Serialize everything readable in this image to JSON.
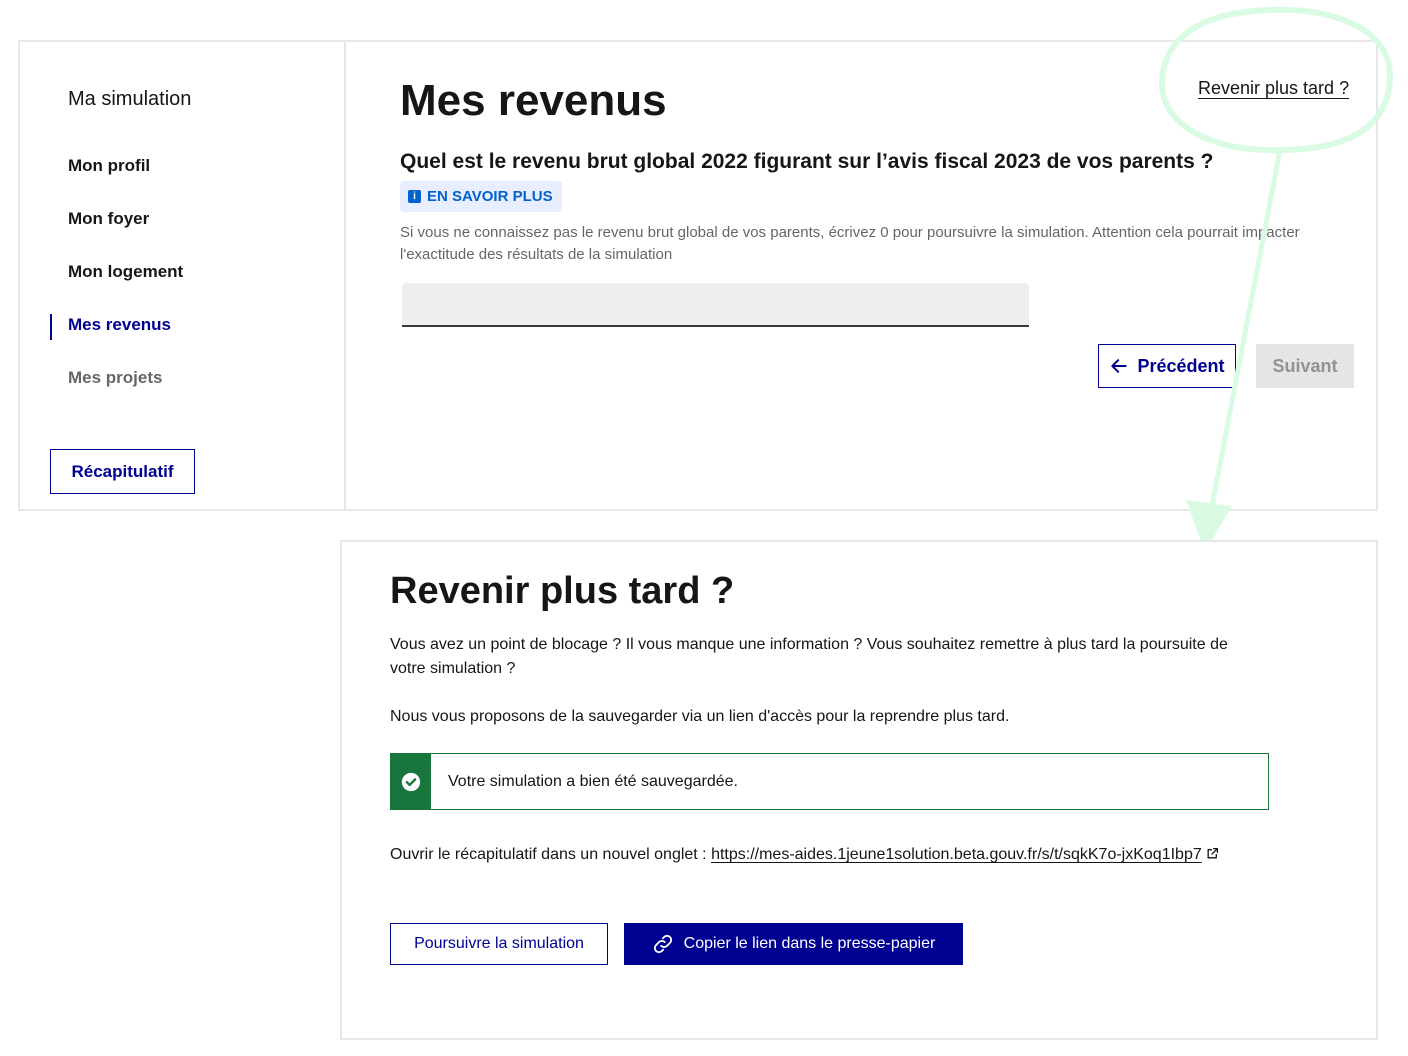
{
  "sidebar": {
    "title": "Ma simulation",
    "items": [
      {
        "label": "Mon profil"
      },
      {
        "label": "Mon foyer"
      },
      {
        "label": "Mon logement"
      },
      {
        "label": "Mes revenus"
      },
      {
        "label": "Mes projets"
      }
    ],
    "active_item": "Mes revenus",
    "recap_button": "Récapitulatif"
  },
  "main": {
    "title": "Mes revenus",
    "later_link": "Revenir plus tard ?",
    "question": "Quel est le revenu brut global 2022 figurant sur l’avis fiscal 2023 de vos parents ?",
    "badge": "EN SAVOIR PLUS",
    "hint": "Si vous ne connaissez pas le revenu brut global de vos parents, écrivez 0 pour poursuivre la simulation. Attention cela pourrait impacter l'exactitude des résultats de la simulation",
    "input_value": "",
    "prev_button": "Précédent",
    "next_button": "Suivant"
  },
  "modal": {
    "title": "Revenir plus tard ?",
    "paragraph1": "Vous avez un point de blocage ? Il vous manque une information ? Vous souhaitez remettre à plus tard la poursuite de votre simulation ?",
    "paragraph2": "Nous vous proposons de la sauvegarder via un lien d'accès pour la reprendre plus tard.",
    "alert": "Votre simulation a bien été sauvegardée.",
    "link_intro": "Ouvrir le récapitulatif dans un nouvel onglet : ",
    "link_url": "https://mes-aides.1jeune1solution.beta.gouv.fr/s/t/sqkK7o-jxKoq1Ibp7",
    "continue_button": "Poursuivre la simulation",
    "copy_button": "Copier le lien dans le presse-papier"
  },
  "colors": {
    "primary": "#000091",
    "success": "#18753c",
    "info": "#0063cb",
    "annotation": "#d9fbe3"
  },
  "icons": [
    "info-icon",
    "arrow-left-icon",
    "check-circle-icon",
    "external-link-icon",
    "link-icon"
  ]
}
